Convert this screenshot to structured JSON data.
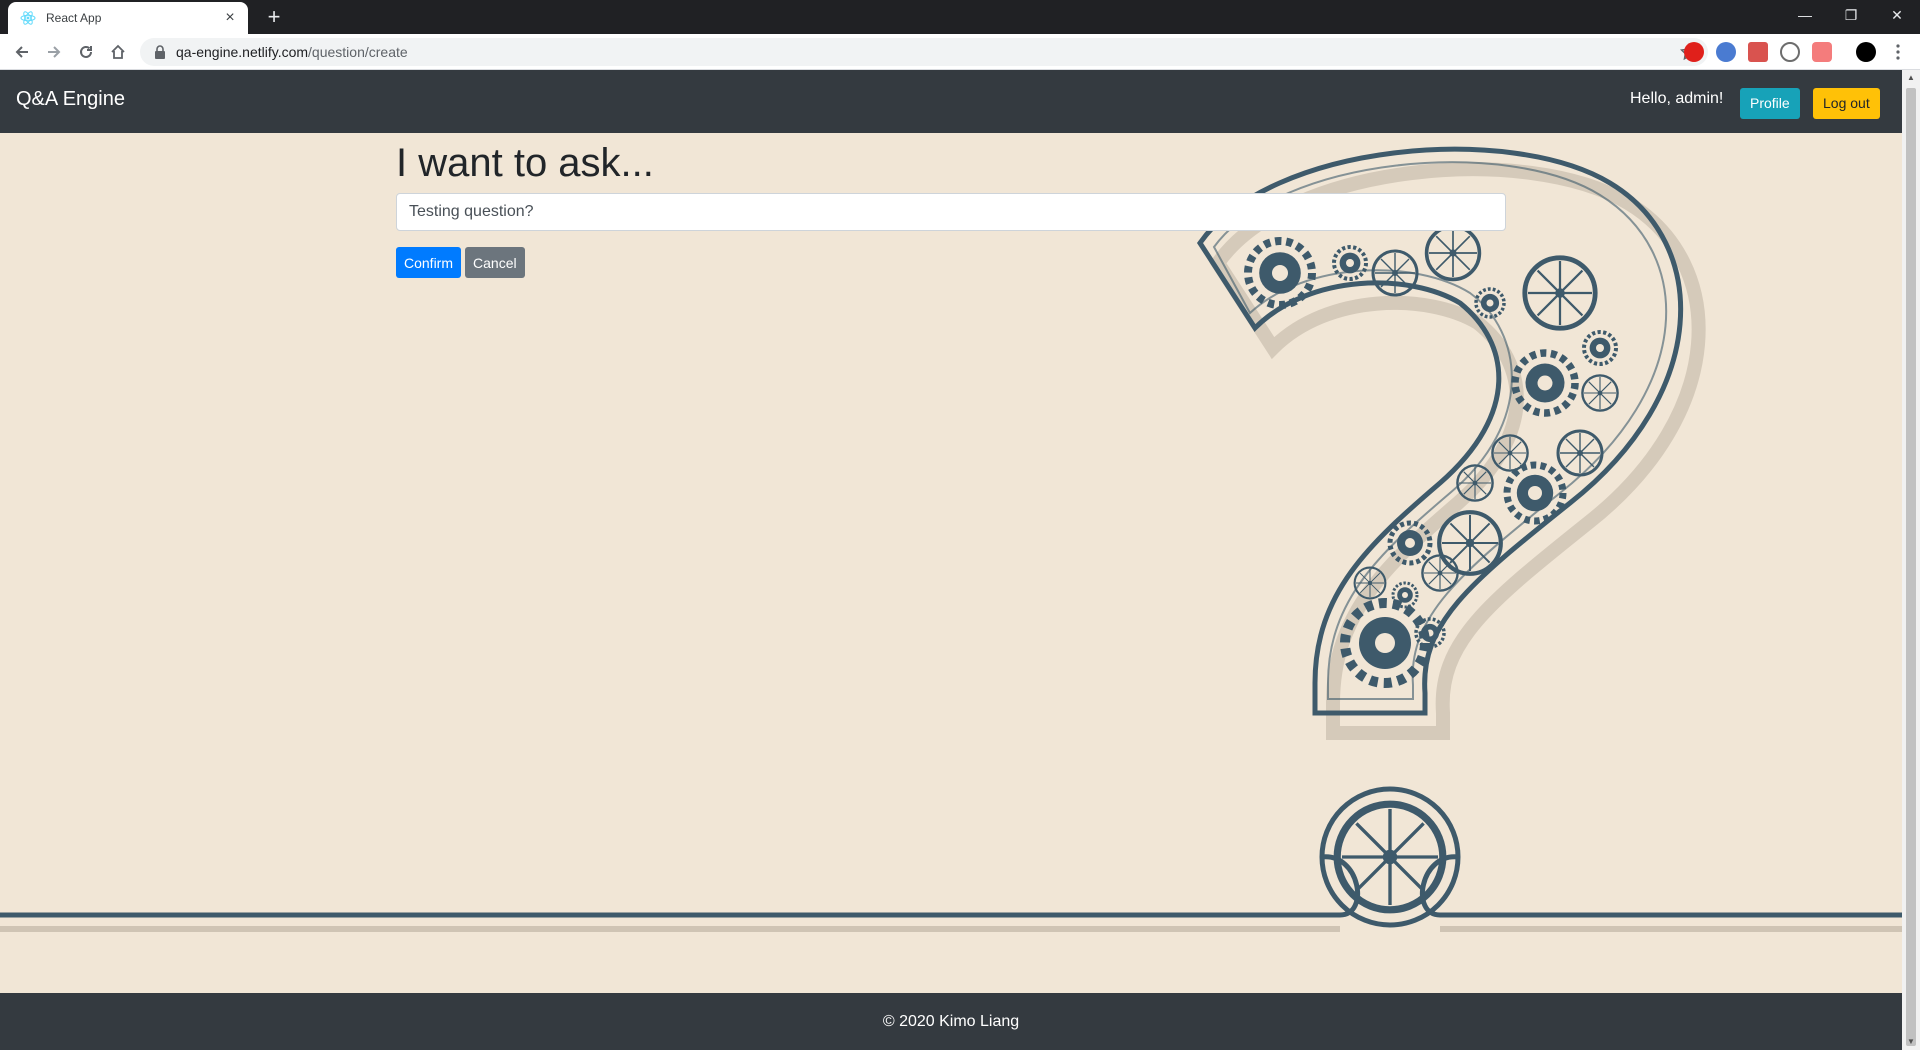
{
  "browser": {
    "tab_title": "React App",
    "url_host": "qa-engine.netlify.com",
    "url_path": "/question/create"
  },
  "navbar": {
    "brand": "Q&A Engine",
    "greeting": "Hello, admin!",
    "profile_label": "Profile",
    "logout_label": "Log out"
  },
  "form": {
    "heading": "I want to ask...",
    "question_value": "Testing question?",
    "confirm_label": "Confirm",
    "cancel_label": "Cancel"
  },
  "footer": {
    "text": "© 2020 Kimo Liang"
  },
  "colors": {
    "navbar_bg": "#343a40",
    "page_bg": "#f1e6d6",
    "primary": "#007bff",
    "secondary": "#6c757d",
    "info": "#17a2b8",
    "warning": "#ffc107",
    "art_stroke": "#3e5a6b"
  }
}
